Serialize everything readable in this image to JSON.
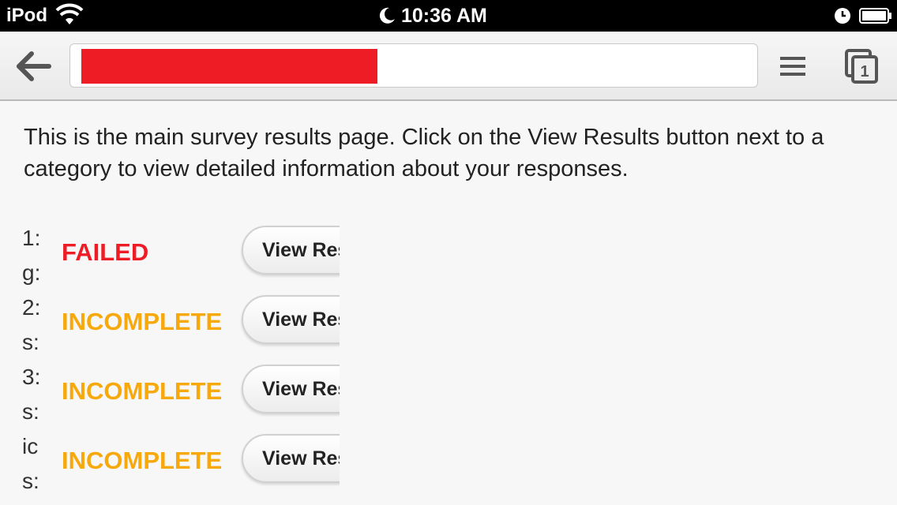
{
  "status_bar": {
    "carrier": "iPod",
    "time": "10:36 AM"
  },
  "toolbar": {
    "url_redacted": true,
    "tab_count": "1"
  },
  "content": {
    "intro": "This is the main survey results page. Click on the View Results button next to a category to view detailed information about your responses.",
    "results": [
      {
        "label": "1:\ng:",
        "status": "FAILED",
        "status_type": "failed",
        "button": "View Results"
      },
      {
        "label": "2:\ns:",
        "status": "INCOMPLETE",
        "status_type": "incomplete",
        "button": "View Results"
      },
      {
        "label": "3:\ns:",
        "status": "INCOMPLETE",
        "status_type": "incomplete",
        "button": "View Results"
      },
      {
        "label": "ic\ns:",
        "status": "INCOMPLETE",
        "status_type": "incomplete",
        "button": "View Results"
      }
    ]
  },
  "colors": {
    "failed": "#ee1c25",
    "incomplete": "#f7a90c",
    "redaction": "#ee1c25"
  }
}
